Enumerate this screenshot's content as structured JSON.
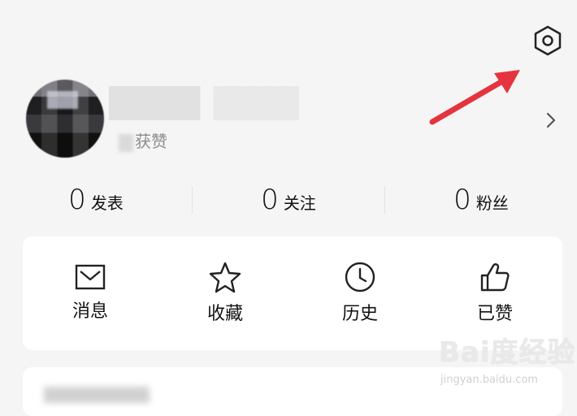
{
  "header": {
    "settings_icon": "hexagon-settings-icon"
  },
  "annotation": {
    "arrow_color": "#e5343f"
  },
  "profile": {
    "subtitle_visible_suffix": "获赞",
    "chevron_icon": "chevron-right-icon"
  },
  "stats": [
    {
      "value": "0",
      "label": "发表"
    },
    {
      "value": "0",
      "label": "关注"
    },
    {
      "value": "0",
      "label": "粉丝"
    }
  ],
  "actions": [
    {
      "label": "消息",
      "icon": "envelope-icon"
    },
    {
      "label": "收藏",
      "icon": "star-icon"
    },
    {
      "label": "历史",
      "icon": "clock-icon"
    },
    {
      "label": "已赞",
      "icon": "thumbs-up-icon"
    }
  ],
  "watermark": {
    "main": "Bai度经验",
    "sub": "jingyan.baidu.com"
  },
  "colors": {
    "background": "#f5f5f5",
    "card": "#ffffff",
    "text": "#111111",
    "muted": "#8c8c8c"
  }
}
